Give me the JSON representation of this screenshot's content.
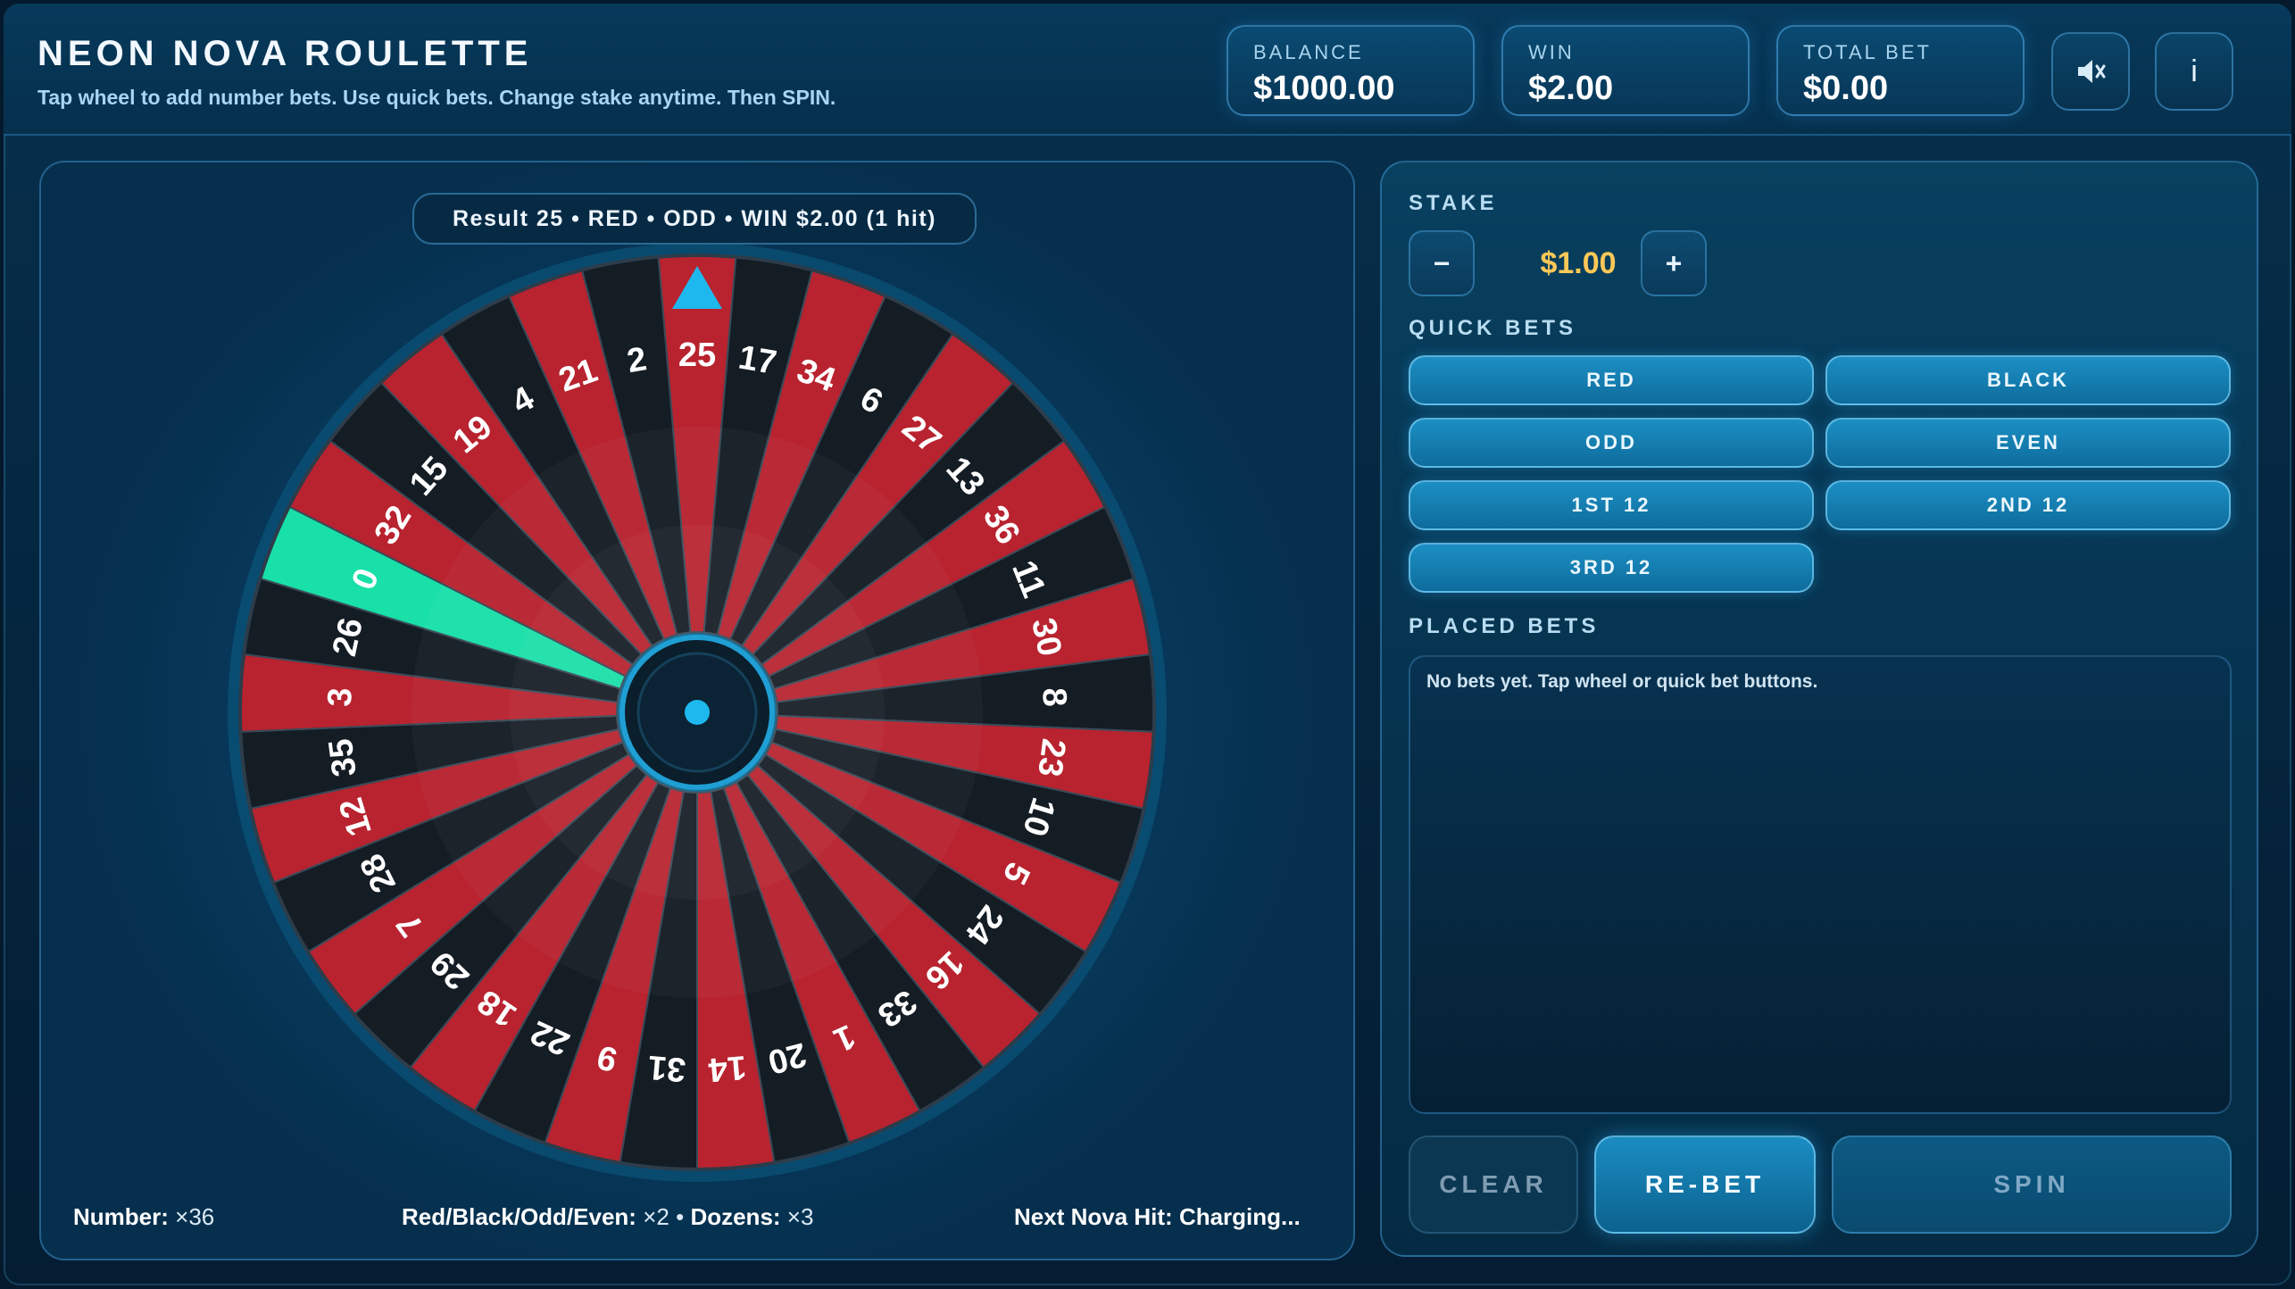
{
  "header": {
    "title": "NEON NOVA ROULETTE",
    "subtitle": "Tap wheel to add number bets. Use quick bets. Change stake anytime. Then SPIN.",
    "balance": {
      "label": "BALANCE",
      "value": "$1000.00"
    },
    "win": {
      "label": "WIN",
      "value": "$2.00"
    },
    "total_bet": {
      "label": "TOTAL BET",
      "value": "$0.00"
    },
    "sound_icon": "speaker-muted-icon",
    "info_label": "i"
  },
  "wheel": {
    "result_text": "Result 25 • RED • ODD • WIN $2.00 (1 hit)",
    "pointer_icon": "triangle-pointer-icon",
    "pointer_number": "25",
    "highlight_number": "0",
    "numbers_clockwise_from_top": [
      "25",
      "17",
      "34",
      "6",
      "27",
      "13",
      "36",
      "11",
      "30",
      "8",
      "23",
      "10",
      "5",
      "24",
      "16",
      "33",
      "1",
      "20",
      "14",
      "31",
      "9",
      "22",
      "18",
      "29",
      "7",
      "28",
      "12",
      "35",
      "3",
      "26",
      "0",
      "32",
      "15",
      "19",
      "4",
      "21",
      "2"
    ],
    "colors": {
      "red": "#b8232f",
      "black": "#141c24",
      "green": "#18e0a8",
      "accent": "#1fb8ee"
    }
  },
  "payouts": {
    "number_label": "Number:",
    "number_value": "×36",
    "rboe_label": "Red/Black/Odd/Even:",
    "rboe_value": "×2",
    "separator": "•",
    "dozens_label": "Dozens:",
    "dozens_value": "×3",
    "nova_label": "Next Nova Hit:",
    "nova_value": "Charging..."
  },
  "stake": {
    "label": "STAKE",
    "minus": "−",
    "value": "$1.00",
    "plus": "+"
  },
  "quick_bets": {
    "label": "QUICK BETS",
    "items": [
      "RED",
      "BLACK",
      "ODD",
      "EVEN",
      "1ST 12",
      "2ND 12",
      "3RD 12"
    ]
  },
  "placed_bets": {
    "label": "PLACED BETS",
    "empty_text": "No bets yet. Tap wheel or quick bet buttons."
  },
  "actions": {
    "clear": "CLEAR",
    "rebet": "RE-BET",
    "spin": "SPIN"
  }
}
